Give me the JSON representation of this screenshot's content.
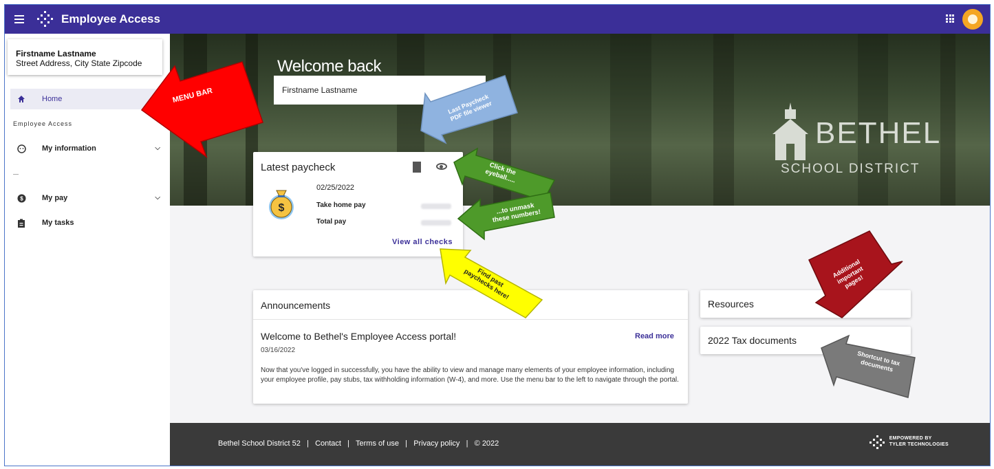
{
  "header": {
    "app_title": "Employee Access"
  },
  "profile": {
    "name": "Firstname Lastname",
    "address": "Street Address, City State Zipcode"
  },
  "sidebar": {
    "home": "Home",
    "section_label": "Employee Access",
    "items": [
      {
        "label": "My information"
      },
      {
        "label": "My pay"
      },
      {
        "label": "My tasks"
      }
    ]
  },
  "hero": {
    "welcome": "Welcome back",
    "name": "Firstname Lastname",
    "district_name": "BETHEL",
    "district_sub": "SCHOOL DISTRICT"
  },
  "paycheck": {
    "title": "Latest paycheck",
    "date": "02/25/2022",
    "take_home_label": "Take home pay",
    "total_label": "Total pay",
    "view_all": "View all checks"
  },
  "announcements": {
    "title": "Announcements",
    "post_title": "Welcome to Bethel's Employee Access portal!",
    "read_more": "Read more",
    "post_date": "03/16/2022",
    "post_body": "Now that you've logged in successfully, you have the ability to view and manage many elements of your employee information, including your employee profile, pay stubs, tax withholding information (W-4), and more. Use the menu bar to the left to navigate through the portal."
  },
  "resources": {
    "title": "Resources"
  },
  "tax_documents": {
    "title": "2022 Tax documents"
  },
  "footer": {
    "district": "Bethel School District 52",
    "contact": "Contact",
    "terms": "Terms of use",
    "privacy": "Privacy policy",
    "copyright": "© 2022",
    "powered_line1": "EMPOWERED BY",
    "powered_line2": "TYLER TECHNOLOGIES"
  },
  "callouts": {
    "menu_bar": "MENU BAR",
    "pdf_line1": "Last Paycheck",
    "pdf_line2": "PDF file viewer",
    "eyeball_line1": "Click the",
    "eyeball_line2": "eyeball.....",
    "unmask_line1": "...to unmask",
    "unmask_line2": "these numbers!",
    "past_line1": "Find past",
    "past_line2": "paychecks here!",
    "additional_line1": "Additional",
    "additional_line2": "important",
    "additional_line3": "pages!",
    "tax_line1": "Shortcut to tax",
    "tax_line2": "documents"
  },
  "colors": {
    "brand": "#3b2f98",
    "menu_arrow": "#ff0000",
    "pdf_arrow": "#8fb3e0",
    "eyeball_arrow": "#4e9a2a",
    "past_arrow": "#ffff00",
    "additional_arrow": "#a8141c",
    "tax_arrow": "#7a7a7a"
  }
}
